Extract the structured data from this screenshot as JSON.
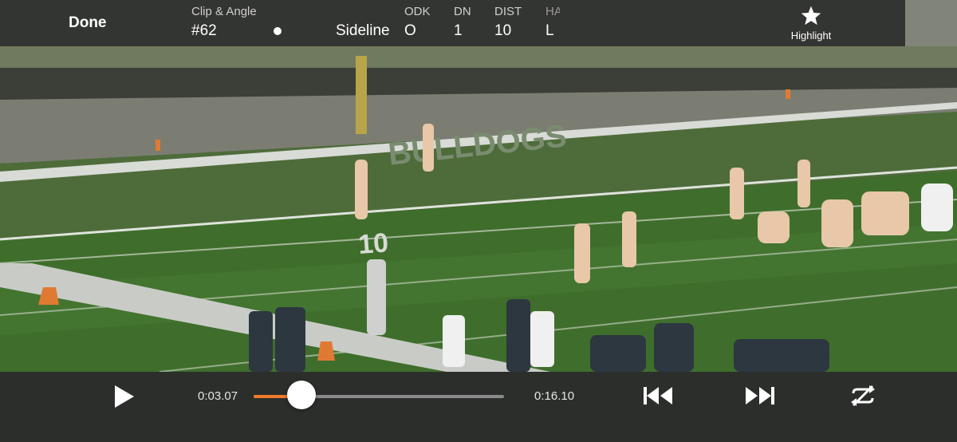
{
  "header": {
    "done_label": "Done",
    "clip_angle_label": "Clip & Angle",
    "clip_number": "#62",
    "angle_value": "Sideline",
    "columns": [
      {
        "label": "ODK",
        "value": "O"
      },
      {
        "label": "DN",
        "value": "1"
      },
      {
        "label": "DIST",
        "value": "10"
      },
      {
        "label": "HA",
        "value": "L"
      }
    ],
    "highlight_label": "Highlight",
    "highlight_icon": "star-icon"
  },
  "video": {
    "scene": "football-field",
    "endzone_text": "BULLDOGS",
    "yard_marker": "10"
  },
  "player": {
    "current_time": "0:03.07",
    "total_time": "0:16.10",
    "progress": 0.19,
    "play_icon": "play-icon",
    "rewind_icon": "skip-back-icon",
    "forward_icon": "skip-forward-icon",
    "loop_icon": "loop-off-icon",
    "accent_color": "#f07a2a"
  }
}
